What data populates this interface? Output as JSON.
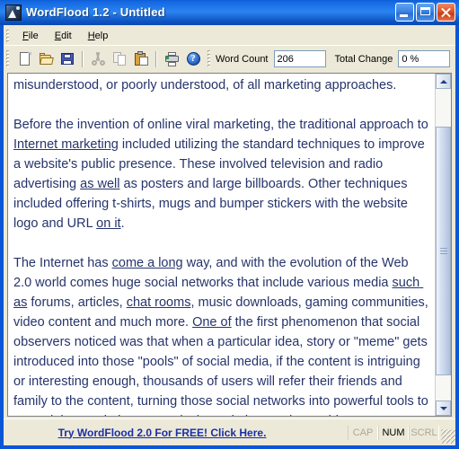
{
  "window": {
    "title": "WordFlood 1.2 - Untitled",
    "app_icon": "wordflood-app-icon",
    "caption": {
      "minimize_label": "Minimize",
      "maximize_label": "Maximize",
      "close_label": "Close"
    }
  },
  "menubar": {
    "items": [
      {
        "label": "File",
        "accel": "F"
      },
      {
        "label": "Edit",
        "accel": "E"
      },
      {
        "label": "Help",
        "accel": "H"
      }
    ]
  },
  "toolbar": {
    "buttons": [
      {
        "name": "new-document",
        "icon": "new-document-icon",
        "enabled": true
      },
      {
        "name": "open-file",
        "icon": "open-folder-icon",
        "enabled": true
      },
      {
        "name": "save-file",
        "icon": "save-floppy-icon",
        "enabled": true
      },
      {
        "name": "cut",
        "icon": "scissors-icon",
        "enabled": false
      },
      {
        "name": "copy",
        "icon": "copy-pages-icon",
        "enabled": false
      },
      {
        "name": "paste",
        "icon": "clipboard-paste-icon",
        "enabled": true
      },
      {
        "name": "print",
        "icon": "printer-icon",
        "enabled": true
      },
      {
        "name": "help",
        "icon": "help-question-icon",
        "enabled": true
      }
    ],
    "word_count": {
      "label": "Word Count",
      "value": "206"
    },
    "total_change": {
      "label": "Total Change",
      "value": "0 %"
    },
    "overflow": {
      "chevrons": "»"
    }
  },
  "editor": {
    "paragraphs": [
      {
        "runs": [
          {
            "text": "misunderstood, or poorly understood, of all marketing approaches.",
            "underline": false
          }
        ]
      },
      {
        "runs": []
      },
      {
        "runs": [
          {
            "text": "Before the invention of online viral marketing, the traditional approach to ",
            "underline": false
          },
          {
            "text": "Internet marketing",
            "underline": true
          },
          {
            "text": " included utilizing the standard techniques to improve a website's public presence. These involved television and radio advertising ",
            "underline": false
          },
          {
            "text": "as well",
            "underline": true
          },
          {
            "text": " as posters and large billboards. Other techniques included offering t-shirts, mugs and bumper stickers with the website logo and URL ",
            "underline": false
          },
          {
            "text": "on it",
            "underline": true
          },
          {
            "text": ".",
            "underline": false
          }
        ]
      },
      {
        "runs": []
      },
      {
        "runs": [
          {
            "text": "The Internet has ",
            "underline": false
          },
          {
            "text": "come a long",
            "underline": true
          },
          {
            "text": " way, and with the evolution of the Web 2.0 world comes huge social networks that include various media ",
            "underline": false
          },
          {
            "text": "such as",
            "underline": true
          },
          {
            "text": " forums, articles, ",
            "underline": false
          },
          {
            "text": "chat rooms",
            "underline": true
          },
          {
            "text": ", music downloads, gaming communities, video content and much more. ",
            "underline": false
          },
          {
            "text": "One of",
            "underline": true
          },
          {
            "text": " the first phenomenon that social observers noticed was that when a particular idea, story or \"meme\" gets introduced into those \"pools\" of social media, if the content is intriguing or interesting enough, thousands of users will refer their friends and family to the content, turning those social networks into powerful tools to spread the word about a particular website, product or idea.",
            "underline": false
          }
        ]
      }
    ],
    "text_color": "#26346b",
    "background_color": "#ffffff",
    "caret_visible": true
  },
  "scrollbar": {
    "orientation": "vertical",
    "up_arrow": "scroll-up-arrow",
    "down_arrow": "scroll-down-arrow",
    "thumb_top_percent": 12,
    "thumb_height_percent": 80
  },
  "statusbar": {
    "promo_link": "Try WordFlood 2.0 For FREE! Click Here.",
    "indicators": [
      {
        "label": "CAP",
        "active": false
      },
      {
        "label": "NUM",
        "active": true
      },
      {
        "label": "SCRL",
        "active": false
      }
    ]
  },
  "colors": {
    "title_bar_blue": "#1d72e8",
    "frame_blue": "#0a56d6",
    "chrome_beige": "#ece9d8",
    "editor_text": "#26346b",
    "link_blue": "#1a2ea8",
    "close_red": "#c93d17"
  }
}
